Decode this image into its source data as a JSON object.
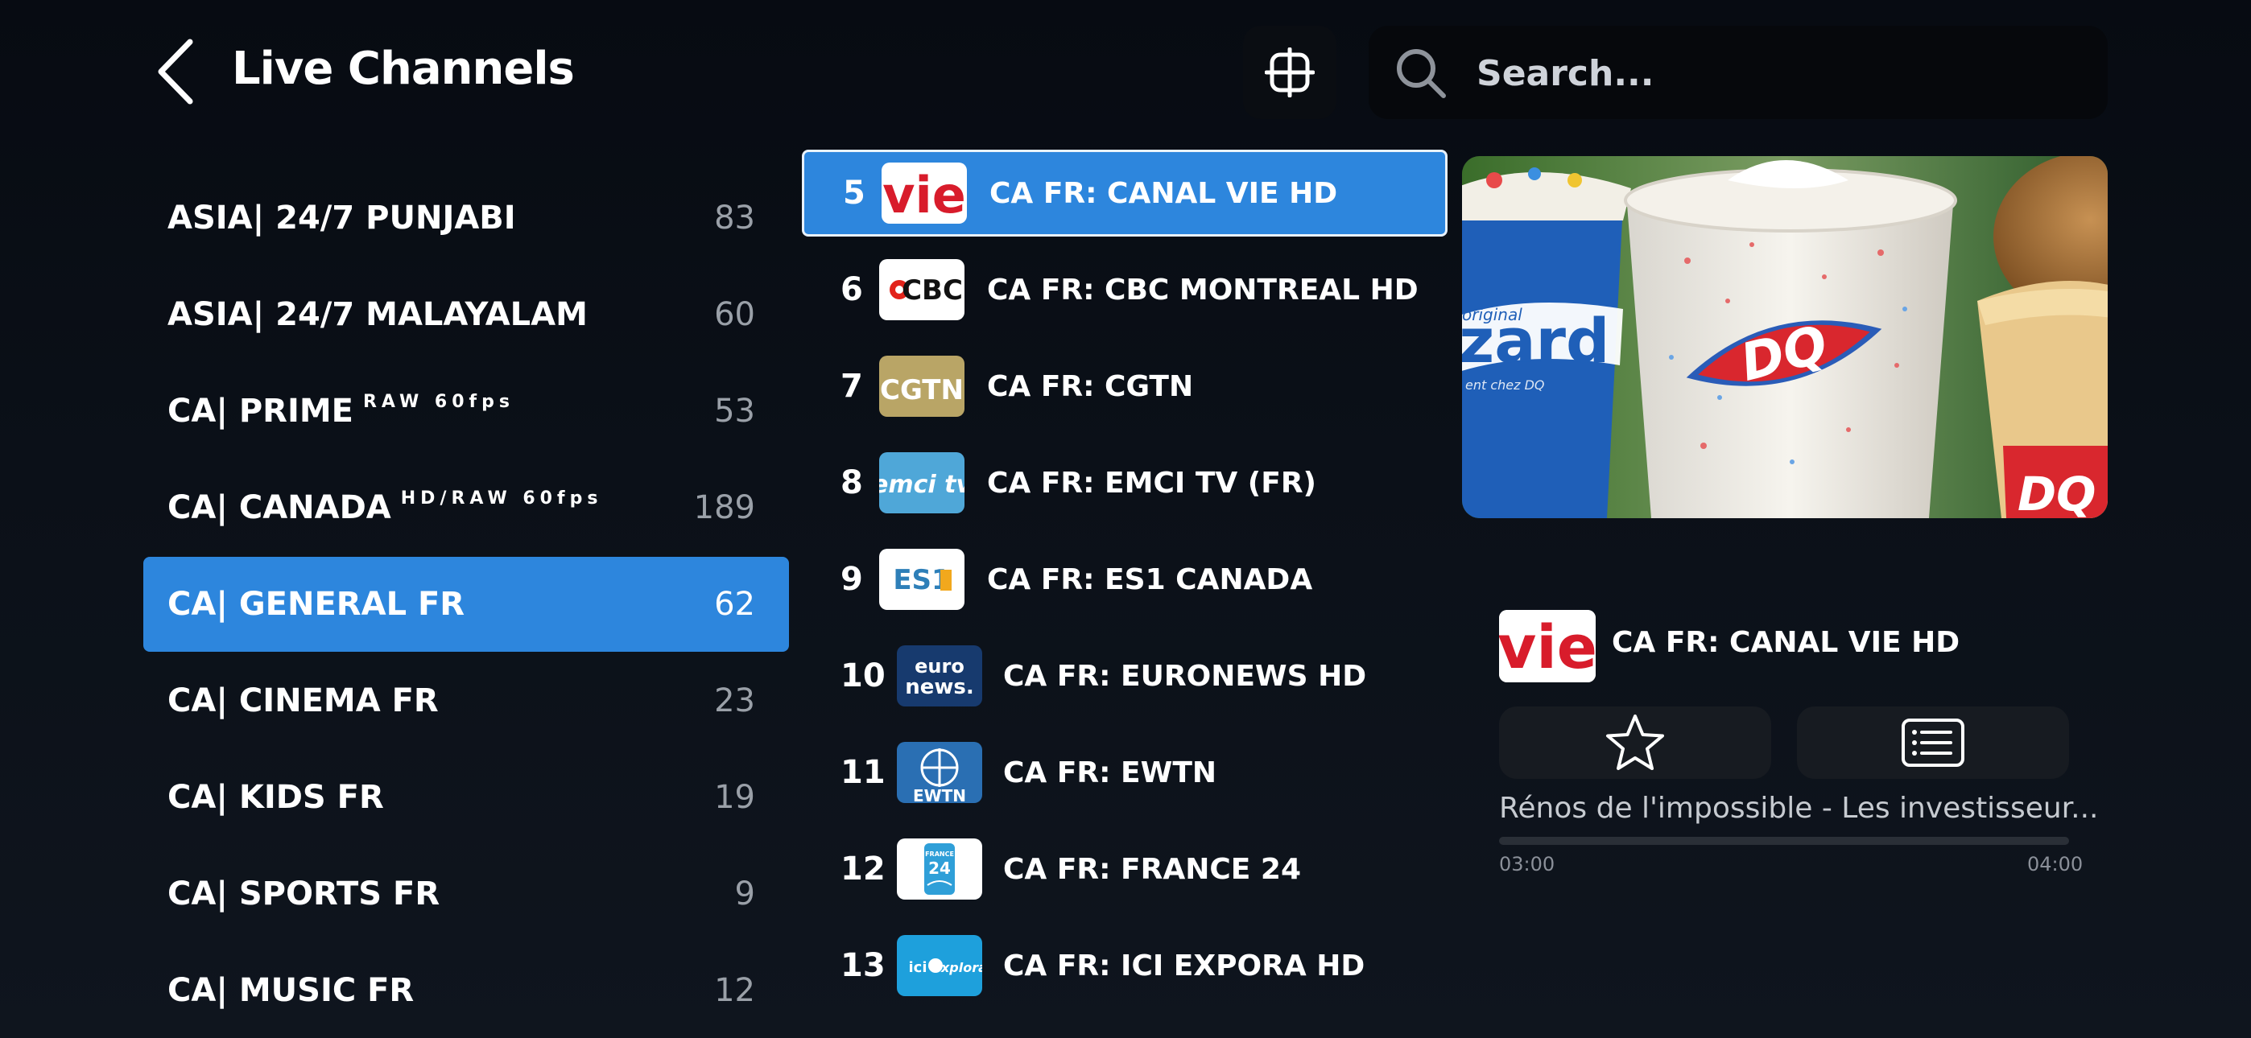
{
  "header": {
    "title": "Live Channels",
    "search_placeholder": "Search..."
  },
  "categories": [
    {
      "name": "ASIA| 24/7 PUNJABI",
      "sup": "",
      "count": "83",
      "selected": false
    },
    {
      "name": "ASIA| 24/7 MALAYALAM",
      "sup": "",
      "count": "60",
      "selected": false
    },
    {
      "name": "CA| PRIME",
      "sup": "RAW 60fps",
      "count": "53",
      "selected": false
    },
    {
      "name": "CA| CANADA",
      "sup": "HD/RAW 60fps",
      "count": "189",
      "selected": false
    },
    {
      "name": "CA| GENERAL FR",
      "sup": "",
      "count": "62",
      "selected": true
    },
    {
      "name": "CA| CINEMA FR",
      "sup": "",
      "count": "23",
      "selected": false
    },
    {
      "name": "CA| KIDS FR",
      "sup": "",
      "count": "19",
      "selected": false
    },
    {
      "name": "CA| SPORTS FR",
      "sup": "",
      "count": "9",
      "selected": false
    },
    {
      "name": "CA| MUSIC FR",
      "sup": "",
      "count": "12",
      "selected": false
    }
  ],
  "channels": [
    {
      "number": "5",
      "name": "CA FR: CANAL VIE HD",
      "logo_text": "vie",
      "logo_icon": "canal-vie-logo",
      "selected": true
    },
    {
      "number": "6",
      "name": "CA FR: CBC MONTREAL HD",
      "logo_text": "CBC",
      "logo_icon": "cbc-logo",
      "selected": false
    },
    {
      "number": "7",
      "name": "CA FR: CGTN",
      "logo_text": "CGTN",
      "logo_icon": "cgtn-logo",
      "selected": false
    },
    {
      "number": "8",
      "name": "CA FR: EMCI TV (FR)",
      "logo_text": "emci tv",
      "logo_icon": "emci-logo",
      "selected": false
    },
    {
      "number": "9",
      "name": "CA FR: ES1 CANADA",
      "logo_text": "ES1",
      "logo_icon": "es1-logo",
      "selected": false
    },
    {
      "number": "10",
      "name": "CA FR: EURONEWS HD",
      "logo_text": "euro news.",
      "logo_icon": "euronews-logo",
      "selected": false
    },
    {
      "number": "11",
      "name": "CA FR: EWTN",
      "logo_text": "EWTN",
      "logo_icon": "ewtn-logo",
      "selected": false
    },
    {
      "number": "12",
      "name": "CA FR: FRANCE 24",
      "logo_text": "FRANCE 24",
      "logo_icon": "france24-logo",
      "selected": false
    },
    {
      "number": "13",
      "name": "CA FR: ICI EXPORA HD",
      "logo_text": "ici explora",
      "logo_icon": "ici-explora-logo",
      "selected": false
    }
  ],
  "now_playing": {
    "channel_name": "CA FR: CANAL VIE HD",
    "logo_text": "vie",
    "program_title": "Rénos de l'impossible - Les investisseur...",
    "start_time": "03:00",
    "end_time": "04:00",
    "progress": 0
  },
  "preview": {
    "brand_text": "DQ",
    "side_text": "zard",
    "side_subtext": "original",
    "side_caption": "ent chez DQ",
    "cone_text": "DQ"
  },
  "icons": {
    "back": "chevron-left-icon",
    "grid": "multiview-grid-icon",
    "search": "search-icon",
    "favorite": "star-icon",
    "epg": "epg-list-icon"
  },
  "colors": {
    "accent": "#2d86dd",
    "background": "#0b1018"
  }
}
